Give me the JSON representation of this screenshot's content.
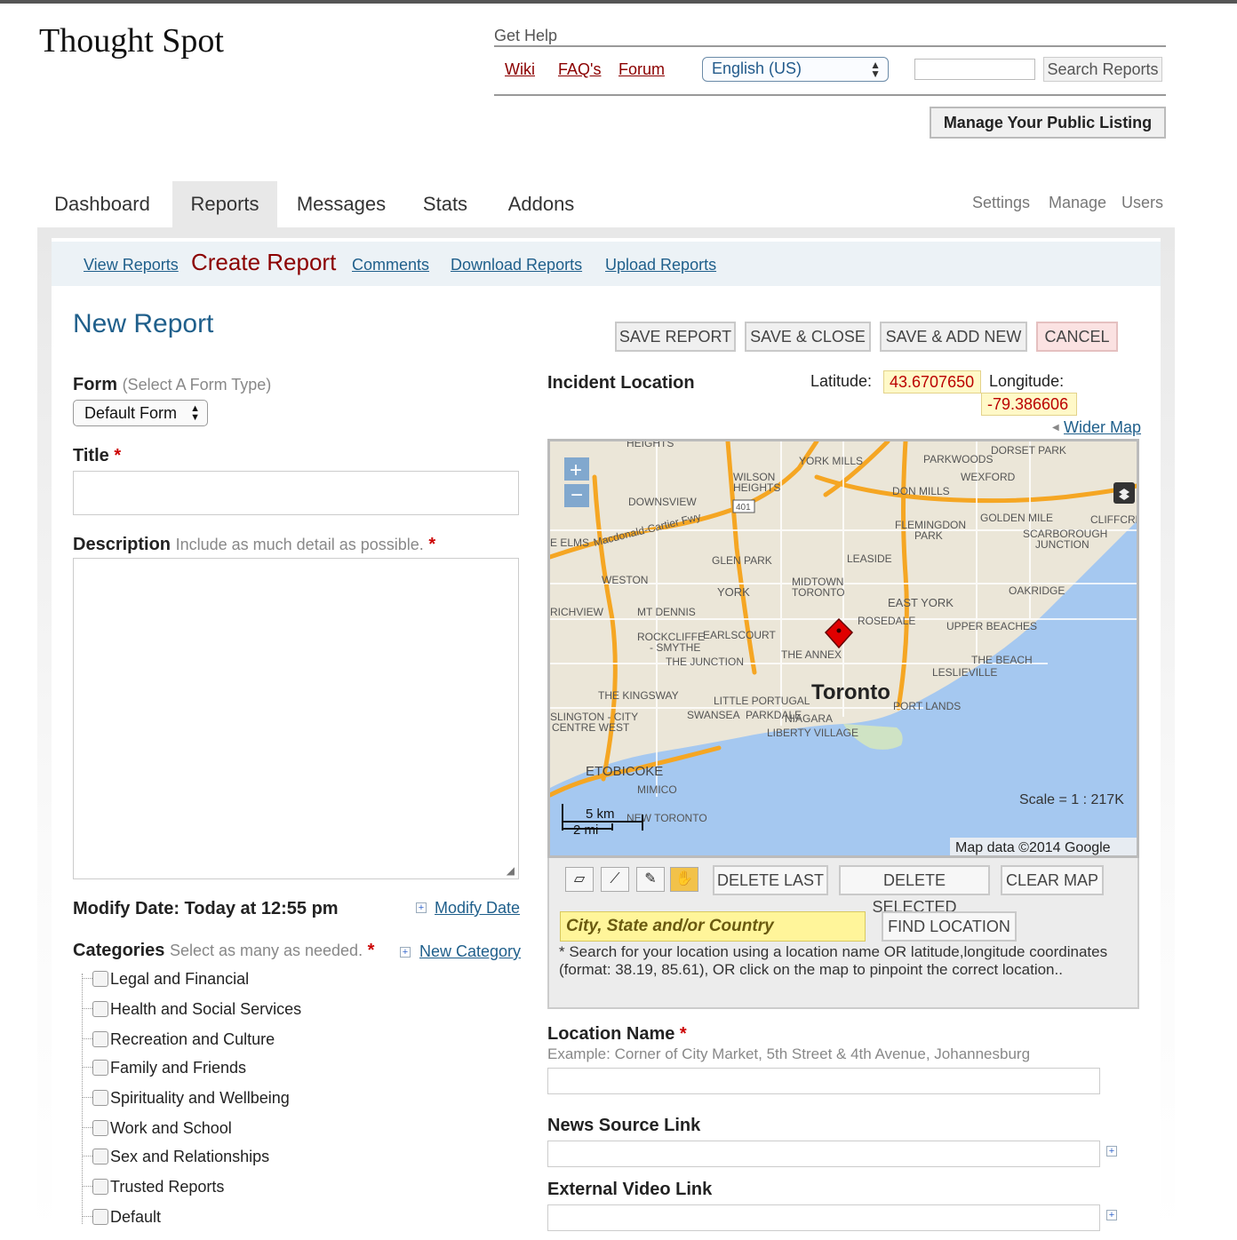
{
  "site": {
    "title": "Thought Spot"
  },
  "help": {
    "title": "Get Help",
    "links": [
      "Wiki",
      "FAQ's",
      "Forum"
    ],
    "language": "English (US)",
    "search_placeholder": "",
    "search_button": "Search Reports",
    "manage_listing": "Manage Your Public Listing"
  },
  "tabs": [
    "Dashboard",
    "Reports",
    "Messages",
    "Stats",
    "Addons"
  ],
  "right_nav": [
    "Settings",
    "Manage",
    "Users"
  ],
  "subnav": {
    "view": "View Reports",
    "create": "Create Report",
    "comments": "Comments",
    "download": "Download Reports",
    "upload": "Upload Reports"
  },
  "page": {
    "title": "New Report",
    "buttons": {
      "save": "SAVE REPORT",
      "save_close": "SAVE & CLOSE",
      "save_add": "SAVE & ADD NEW",
      "cancel": "CANCEL"
    }
  },
  "form": {
    "form_label": "Form",
    "form_hint": "(Select A Form Type)",
    "form_value": "Default Form",
    "title_label": "Title",
    "description_label": "Description",
    "description_hint": "Include as much detail as possible.",
    "modify_date_label": "Modify Date: Today at 12:55 pm",
    "modify_date_link": "Modify Date",
    "categories_label": "Categories",
    "categories_hint": "Select as many as needed.",
    "new_category_link": "New Category",
    "categories": [
      "Legal and Financial",
      "Health and Social Services",
      "Recreation and Culture",
      "Family and Friends",
      "Spirituality and Wellbeing",
      "Work and School",
      "Sex and Relationships",
      "Trusted Reports",
      "Default"
    ]
  },
  "location": {
    "label": "Incident Location",
    "lat_label": "Latitude:",
    "lat_value": "43.6707650",
    "lon_label": "Longitude:",
    "lon_value": "-79.386606",
    "wider_map": "Wider Map",
    "map": {
      "city": "Toronto",
      "scale": "Scale = 1 : 217K",
      "attribution": "Map data ©2014 Google",
      "scale_km": "5 km",
      "scale_mi": "2 mi",
      "places": [
        "YORK MILLS",
        "PARKWOODS",
        "DORSET PARK",
        "WILSON HEIGHTS",
        "WEXFORD",
        "DON MILLS",
        "DOWNSVIEW",
        "401",
        "Macdonald-Cartier Fwy",
        "GOLDEN MILE",
        "FLEMINGDON PARK",
        "CLIFFCREST",
        "SCARBOROUGH JUNCTION",
        "GLEN PARK",
        "LEASIDE",
        "WESTON",
        "MIDTOWN TORONTO",
        "YORK",
        "OAKRIDGE",
        "MT DENNIS",
        "EAST YORK",
        "ROSEDALE",
        "UPPER BEACHES",
        "ROCKCLIFFE - SMYTHE",
        "EARLSCOURT",
        "THE JUNCTION",
        "THE ANNEX",
        "LESLIEVILLE",
        "THE BEACH",
        "THE KINGSWAY",
        "LITTLE PORTUGAL",
        "PORT LANDS",
        "SWANSEA",
        "PARKDALE",
        "NIAGARA",
        "LIBERTY VILLAGE",
        "ETOBICOKE",
        "MIMICO",
        "NEW TORONTO",
        "E ELMS",
        "RICHVIEW",
        "ISLINGTON - CITY CENTRE WEST",
        "HEIGHTS"
      ]
    },
    "tool_buttons": {
      "delete_last": "DELETE LAST",
      "delete_selected": "DELETE SELECTED",
      "clear_map": "CLEAR MAP"
    },
    "city_placeholder": "City, State and/or Country",
    "find_location": "FIND LOCATION",
    "help_text": "* Search for your location using a location name OR latitude,longitude coordinates (format: 38.19, 85.61), OR click on the map to pinpoint the correct location..",
    "location_name_label": "Location Name",
    "location_name_hint": "Example: Corner of City Market, 5th Street & 4th Avenue, Johannesburg",
    "news_source_label": "News Source Link",
    "video_label": "External Video Link"
  },
  "colors": {
    "link_red": "#8b0000",
    "link_blue": "#1f5f8b",
    "marker": "#e00000",
    "water": "#a5c8f0"
  }
}
